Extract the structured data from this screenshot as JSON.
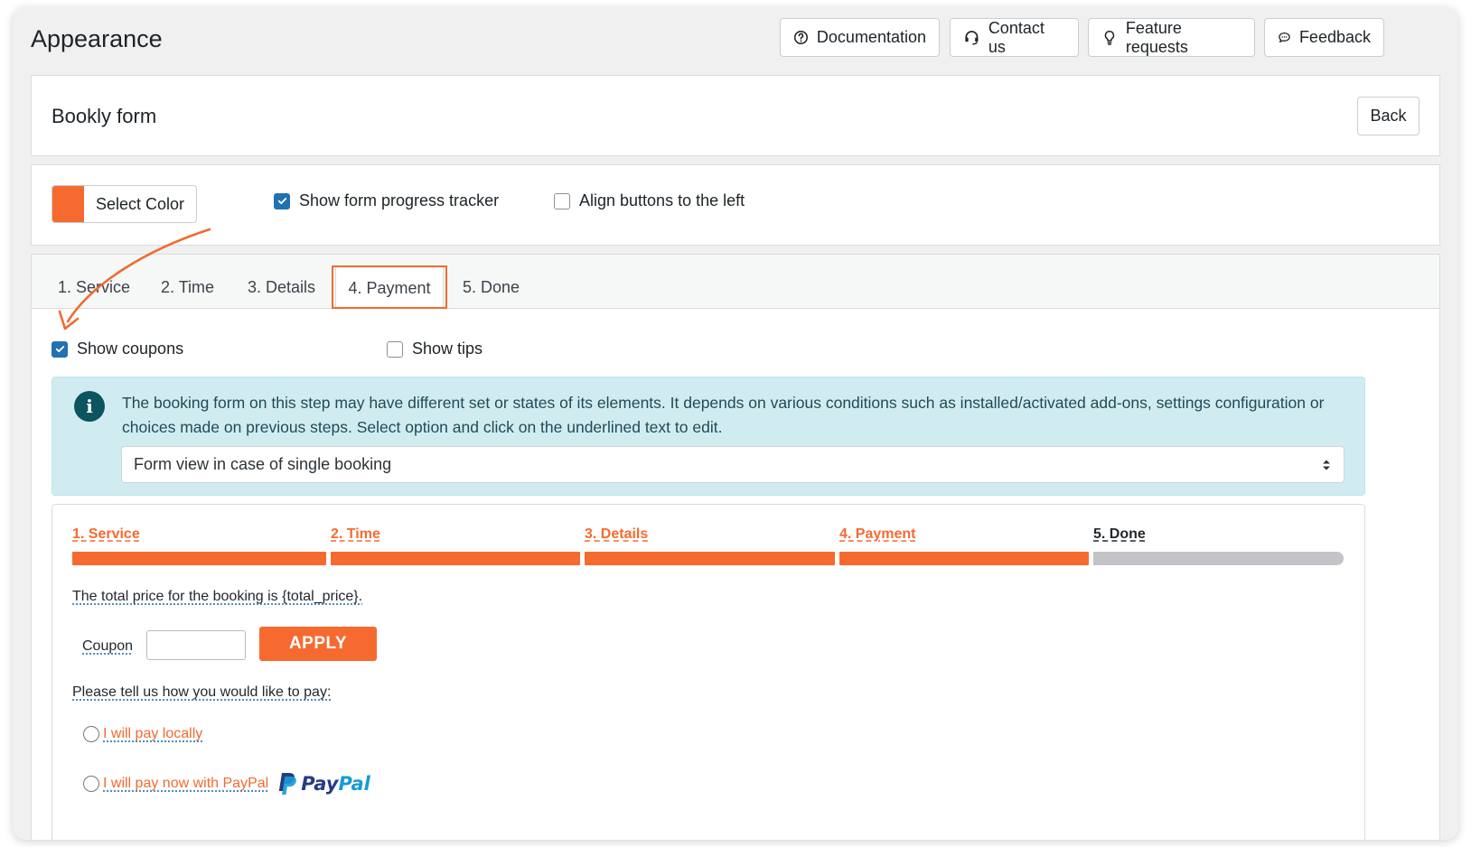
{
  "header": {
    "title": "Appearance",
    "buttons": [
      {
        "label": "Documentation",
        "icon": "question-circle-icon"
      },
      {
        "label": "Contact us",
        "icon": "headset-icon"
      },
      {
        "label": "Feature requests",
        "icon": "lightbulb-icon"
      },
      {
        "label": "Feedback",
        "icon": "chat-bubble-icon"
      }
    ]
  },
  "form_card": {
    "title": "Bookly form",
    "back_label": "Back"
  },
  "settings": {
    "select_color_label": "Select Color",
    "color": "#f66a2f",
    "show_progress_tracker": {
      "label": "Show form progress tracker",
      "checked": true
    },
    "align_buttons_left": {
      "label": "Align buttons to the left",
      "checked": false
    }
  },
  "tabs": [
    {
      "label": "1. Service"
    },
    {
      "label": "2. Time"
    },
    {
      "label": "3. Details"
    },
    {
      "label": "4. Payment",
      "active": true
    },
    {
      "label": "5. Done"
    }
  ],
  "payment_options": {
    "show_coupons": {
      "label": "Show coupons",
      "checked": true
    },
    "show_tips": {
      "label": "Show tips",
      "checked": false
    }
  },
  "info": {
    "text": "The booking form on this step may have different set or states of its elements. It depends on various conditions such as installed/activated add-ons, settings configuration or choices made on previous steps. Select option and click on the underlined text to edit.",
    "select_value": "Form view in case of single booking"
  },
  "preview": {
    "steps": [
      {
        "label": "1. Service",
        "done": true
      },
      {
        "label": "2. Time",
        "done": true
      },
      {
        "label": "3. Details",
        "done": true
      },
      {
        "label": "4. Payment",
        "done": true
      },
      {
        "label": "5. Done",
        "done": false
      }
    ],
    "total_price_text": "The total price for the booking is {total_price}.",
    "coupon_label": "Coupon",
    "apply_label": "APPLY",
    "pay_prompt": "Please tell us how you would like to pay:",
    "pay_local_label": "I will pay locally",
    "pay_paypal_label": "I will pay now with PayPal",
    "paypal_logo": {
      "part1": "Pay",
      "part2": "Pal"
    }
  },
  "colors": {
    "accent": "#f66a2f",
    "inactive_bar": "#c3c4c7",
    "done_label": "#23282d",
    "paypal_dark": "#253b80",
    "paypal_light": "#179bd7"
  }
}
